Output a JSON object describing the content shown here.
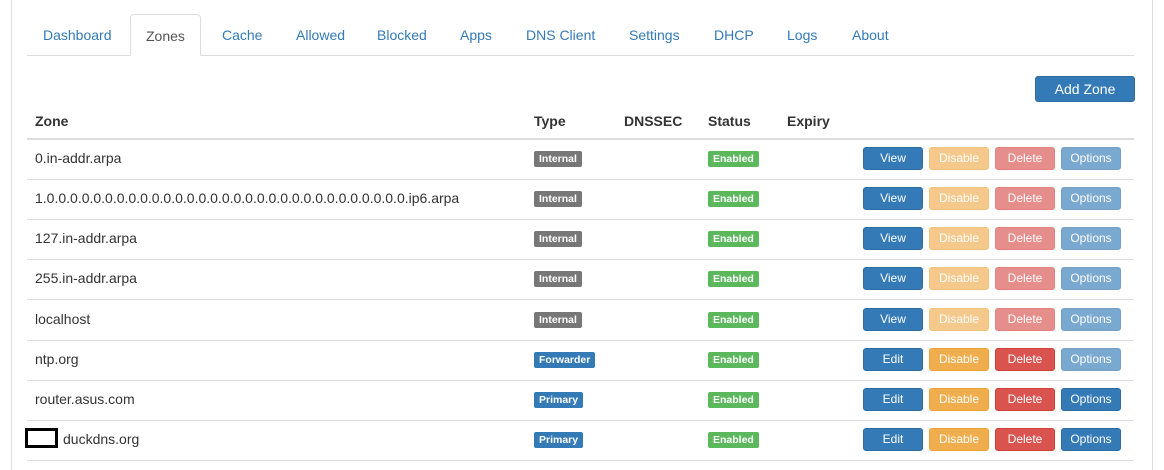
{
  "tabs": [
    "Dashboard",
    "Zones",
    "Cache",
    "Allowed",
    "Blocked",
    "Apps",
    "DNS Client",
    "Settings",
    "DHCP",
    "Logs",
    "About"
  ],
  "active_tab": "Zones",
  "add_zone_label": "Add Zone",
  "columns": {
    "zone": "Zone",
    "type": "Type",
    "dnssec": "DNSSEC",
    "status": "Status",
    "expiry": "Expiry"
  },
  "zones": [
    {
      "name": "0.in-addr.arpa",
      "type": "Internal",
      "status": "Enabled",
      "action": "View",
      "disabled": true
    },
    {
      "name": "1.0.0.0.0.0.0.0.0.0.0.0.0.0.0.0.0.0.0.0.0.0.0.0.0.0.0.0.0.0.0.0.ip6.arpa",
      "type": "Internal",
      "status": "Enabled",
      "action": "View",
      "disabled": true
    },
    {
      "name": "127.in-addr.arpa",
      "type": "Internal",
      "status": "Enabled",
      "action": "View",
      "disabled": true
    },
    {
      "name": "255.in-addr.arpa",
      "type": "Internal",
      "status": "Enabled",
      "action": "View",
      "disabled": true
    },
    {
      "name": "localhost",
      "type": "Internal",
      "status": "Enabled",
      "action": "View",
      "disabled": true
    },
    {
      "name": "ntp.org",
      "type": "Forwarder",
      "status": "Enabled",
      "action": "Edit",
      "disabled": false,
      "options_disabled": true
    },
    {
      "name": "router.asus.com",
      "type": "Primary",
      "status": "Enabled",
      "action": "Edit",
      "disabled": false
    },
    {
      "name": "duckdns.org",
      "type": "Primary",
      "status": "Enabled",
      "action": "Edit",
      "disabled": false,
      "redacted_prefix": true
    }
  ],
  "buttons": {
    "disable": "Disable",
    "delete": "Delete",
    "options": "Options"
  },
  "colors": {
    "primary": "#337ab7",
    "warning": "#f0ad4e",
    "danger": "#d9534f",
    "success": "#5cb85c",
    "default_label": "#777777"
  }
}
